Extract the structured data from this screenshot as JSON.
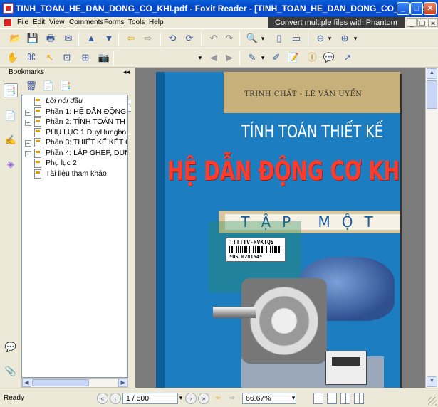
{
  "window": {
    "title": "TINH_TOAN_HE_DAN_DONG_CO_KHI.pdf - Foxit Reader - [TINH_TOAN_HE_DAN_DONG_CO_KHI.pdf]",
    "min": "_",
    "max": "□",
    "close": "✕",
    "doc_min": "_",
    "doc_restore": "❐",
    "doc_close": "✕"
  },
  "menu": {
    "items": [
      "File",
      "Edit",
      "View",
      "Comments",
      "Forms",
      "Tools",
      "Help"
    ]
  },
  "promo": "Convert multiple files with Phantom",
  "search": {
    "placeholder": "Find"
  },
  "bookmarks_panel": {
    "title": "Bookmarks",
    "collapse": "◂◂",
    "items": [
      {
        "label": "Lời nói đầu",
        "expandable": false,
        "expander": ""
      },
      {
        "label": "Phần 1:   HỆ DẪN ĐỘNG",
        "expandable": true,
        "expander": "+"
      },
      {
        "label": "Phần 2:   TÍNH TOÁN TH",
        "expandable": true,
        "expander": "+"
      },
      {
        "label": "PHỤ LỤC 1 DuyHungbn.",
        "expandable": false,
        "expander": ""
      },
      {
        "label": "Phần 3:  THIẾT KẾ KẾT C",
        "expandable": true,
        "expander": "+"
      },
      {
        "label": "Phần 4:  LẮP GHÉP, DUN",
        "expandable": true,
        "expander": "+"
      },
      {
        "label": "Phụ lục 2",
        "expandable": false,
        "expander": ""
      },
      {
        "label": "Tài liệu tham khảo",
        "expandable": false,
        "expander": ""
      }
    ]
  },
  "cover": {
    "authors": "TRỊNH CHẤT - LÊ VĂN UYỂN",
    "title_line1": "TÍNH TOÁN THIẾT KẾ",
    "title_line2": "HỆ DẪN ĐỘNG CƠ KHÍ",
    "volume": "TẬP MỘT",
    "barcode_line1": "TTTTTV-HVKTQS",
    "barcode_line2": "*DS 028154*"
  },
  "status": {
    "ready": "Ready",
    "page": "1 / 500",
    "zoom": "66.67%"
  },
  "icons": {
    "first": "«",
    "prev": "‹",
    "next": "›",
    "last": "»",
    "back": "⇦",
    "fwd": "⇨",
    "drop": "▾",
    "up": "▲",
    "down": "▼",
    "left": "◀",
    "right": "▶"
  }
}
